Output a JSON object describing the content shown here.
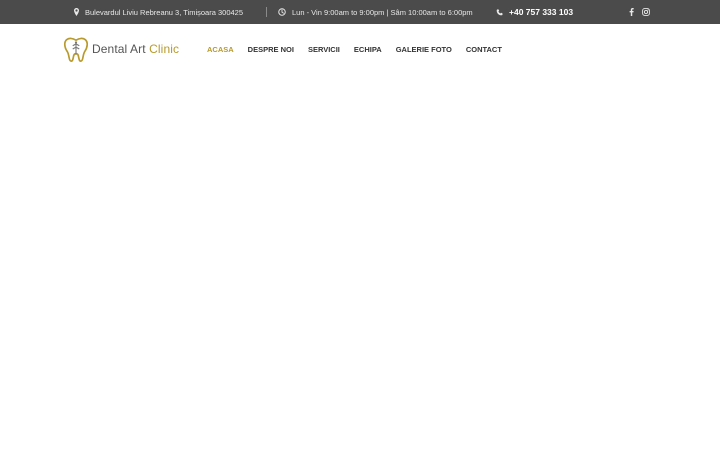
{
  "topbar": {
    "address": "Bulevardul Liviu Rebreanu 3, Timișoara 300425",
    "hours": "Lun - Vin 9:00am to 9:00pm | Sâm 10:00am to 6:00pm",
    "phone": "+40 757 333 103",
    "icons": {
      "address": "map-marker-icon",
      "hours": "clock-icon",
      "phone": "phone-icon",
      "facebook": "facebook-icon",
      "instagram": "instagram-icon"
    }
  },
  "logo": {
    "text_main": "Dental Art ",
    "text_accent": "Clinic",
    "icon": "tooth-logo-icon"
  },
  "nav": {
    "items": [
      {
        "label": "ACASA",
        "active": true
      },
      {
        "label": "DESPRE NOI",
        "active": false
      },
      {
        "label": "SERVICII",
        "active": false
      },
      {
        "label": "ECHIPA",
        "active": false
      },
      {
        "label": "GALERIE FOTO",
        "active": false
      },
      {
        "label": "CONTACT",
        "active": false
      }
    ]
  },
  "colors": {
    "topbar_bg": "#4b4b4b",
    "accent": "#b89a2d",
    "nav_text": "#333333"
  }
}
